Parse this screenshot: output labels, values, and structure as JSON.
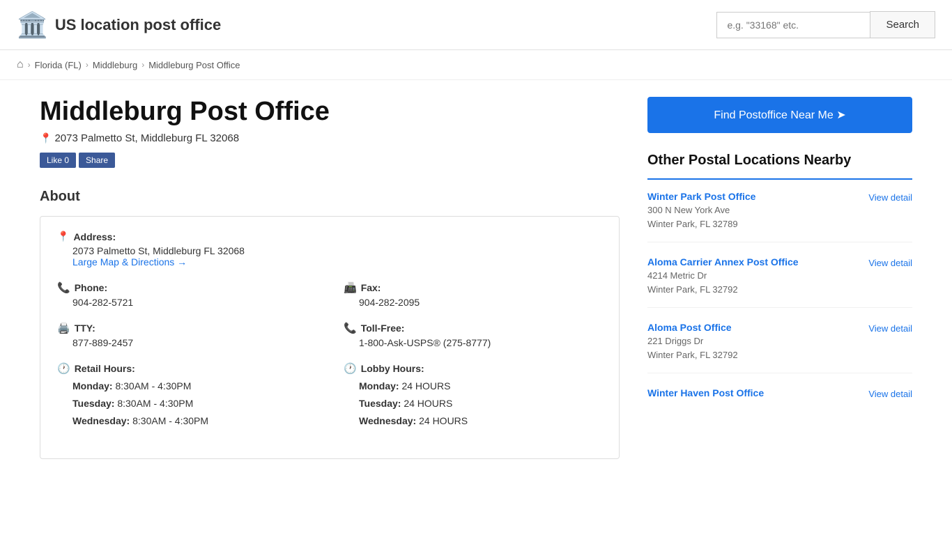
{
  "header": {
    "logo_icon": "🏛️",
    "logo_text": "US location post office",
    "search_placeholder": "e.g. \"33168\" etc.",
    "search_label": "Search"
  },
  "breadcrumb": {
    "home_icon": "⌂",
    "items": [
      {
        "label": "Florida (FL)",
        "href": "#"
      },
      {
        "label": "Middleburg",
        "href": "#"
      },
      {
        "label": "Middleburg Post Office",
        "href": "#"
      }
    ]
  },
  "page": {
    "title": "Middleburg Post Office",
    "address_pin": "📍",
    "address": "2073 Palmetto St, Middleburg FL 32068",
    "fb_like": "Like 0",
    "fb_share": "Share",
    "about_title": "About",
    "address_label": "Address:",
    "address_value": "2073 Palmetto St, Middleburg FL 32068",
    "address_link": "Large Map & Directions →",
    "phone_label": "Phone:",
    "phone_value": "904-282-5721",
    "fax_label": "Fax:",
    "fax_value": "904-282-2095",
    "tty_label": "TTY:",
    "tty_value": "877-889-2457",
    "tollfree_label": "Toll-Free:",
    "tollfree_value": "1-800-Ask-USPS® (275-8777)",
    "retail_hours_label": "Retail Hours:",
    "retail_hours": [
      {
        "day": "Monday:",
        "hours": "8:30AM - 4:30PM"
      },
      {
        "day": "Tuesday:",
        "hours": "8:30AM - 4:30PM"
      },
      {
        "day": "Wednesday:",
        "hours": "8:30AM - 4:30PM"
      }
    ],
    "lobby_hours_label": "Lobby Hours:",
    "lobby_hours": [
      {
        "day": "Monday:",
        "hours": "24 HOURS"
      },
      {
        "day": "Tuesday:",
        "hours": "24 HOURS"
      },
      {
        "day": "Wednesday:",
        "hours": "24 HOURS"
      }
    ]
  },
  "sidebar": {
    "find_btn": "Find Postoffice Near Me ➤",
    "nearby_title": "Other Postal Locations Nearby",
    "nearby_items": [
      {
        "name": "Winter Park Post Office",
        "addr1": "300 N New York Ave",
        "addr2": "Winter Park, FL 32789",
        "view_detail": "View detail"
      },
      {
        "name": "Aloma Carrier Annex Post Office",
        "addr1": "4214 Metric Dr",
        "addr2": "Winter Park, FL 32792",
        "view_detail": "View detail"
      },
      {
        "name": "Aloma Post Office",
        "addr1": "221 Driggs Dr",
        "addr2": "Winter Park, FL 32792",
        "view_detail": "View detail"
      },
      {
        "name": "Winter Haven Post Office",
        "addr1": "",
        "addr2": "",
        "view_detail": "View detail"
      }
    ]
  }
}
